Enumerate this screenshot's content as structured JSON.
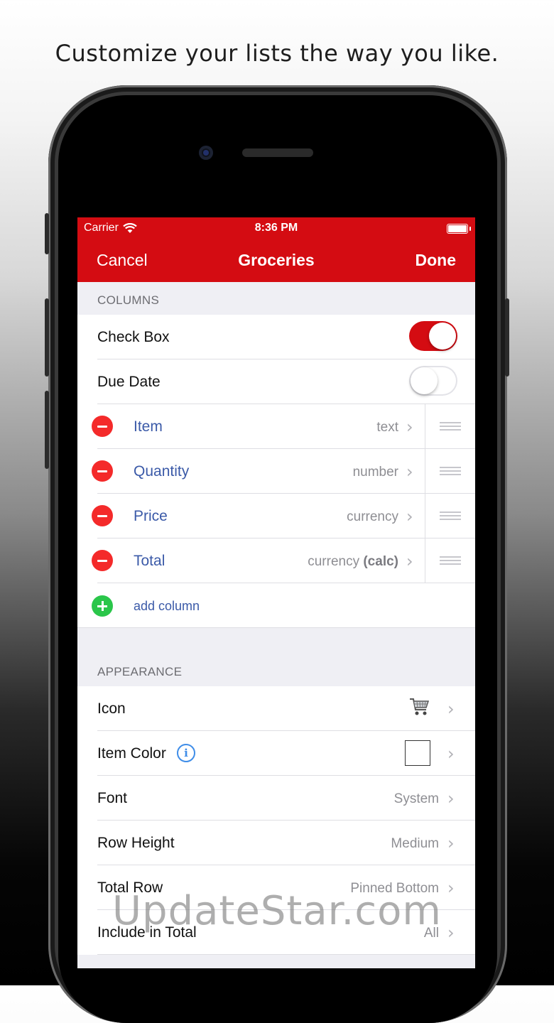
{
  "tagline": "Customize your lists the way you like.",
  "status_bar": {
    "carrier": "Carrier",
    "time": "8:36 PM"
  },
  "nav": {
    "cancel": "Cancel",
    "title": "Groceries",
    "done": "Done"
  },
  "columns_section": {
    "header": "COLUMNS",
    "check_box": {
      "label": "Check Box",
      "enabled": true
    },
    "due_date": {
      "label": "Due Date",
      "enabled": false
    },
    "items": [
      {
        "label": "Item",
        "type": "text"
      },
      {
        "label": "Quantity",
        "type": "number"
      },
      {
        "label": "Price",
        "type": "currency"
      },
      {
        "label": "Total",
        "type": "currency",
        "type_suffix": "(calc)"
      }
    ],
    "add_column": "add column"
  },
  "appearance_section": {
    "header": "APPEARANCE",
    "icon": {
      "label": "Icon",
      "value_icon": "shopping-cart-icon"
    },
    "item_color": {
      "label": "Item Color",
      "value_color": "#ffffff"
    },
    "font": {
      "label": "Font",
      "value": "System"
    },
    "row_height": {
      "label": "Row Height",
      "value": "Medium"
    },
    "total_row": {
      "label": "Total Row",
      "value": "Pinned Bottom"
    },
    "include_in_total": {
      "label": "Include in Total",
      "value": "All"
    }
  },
  "watermark": "UpdateStar.com",
  "colors": {
    "brand_red": "#d40c12",
    "link_blue": "#3b5aa8",
    "delete_red": "#f42a2a",
    "add_green": "#2ac64a"
  }
}
